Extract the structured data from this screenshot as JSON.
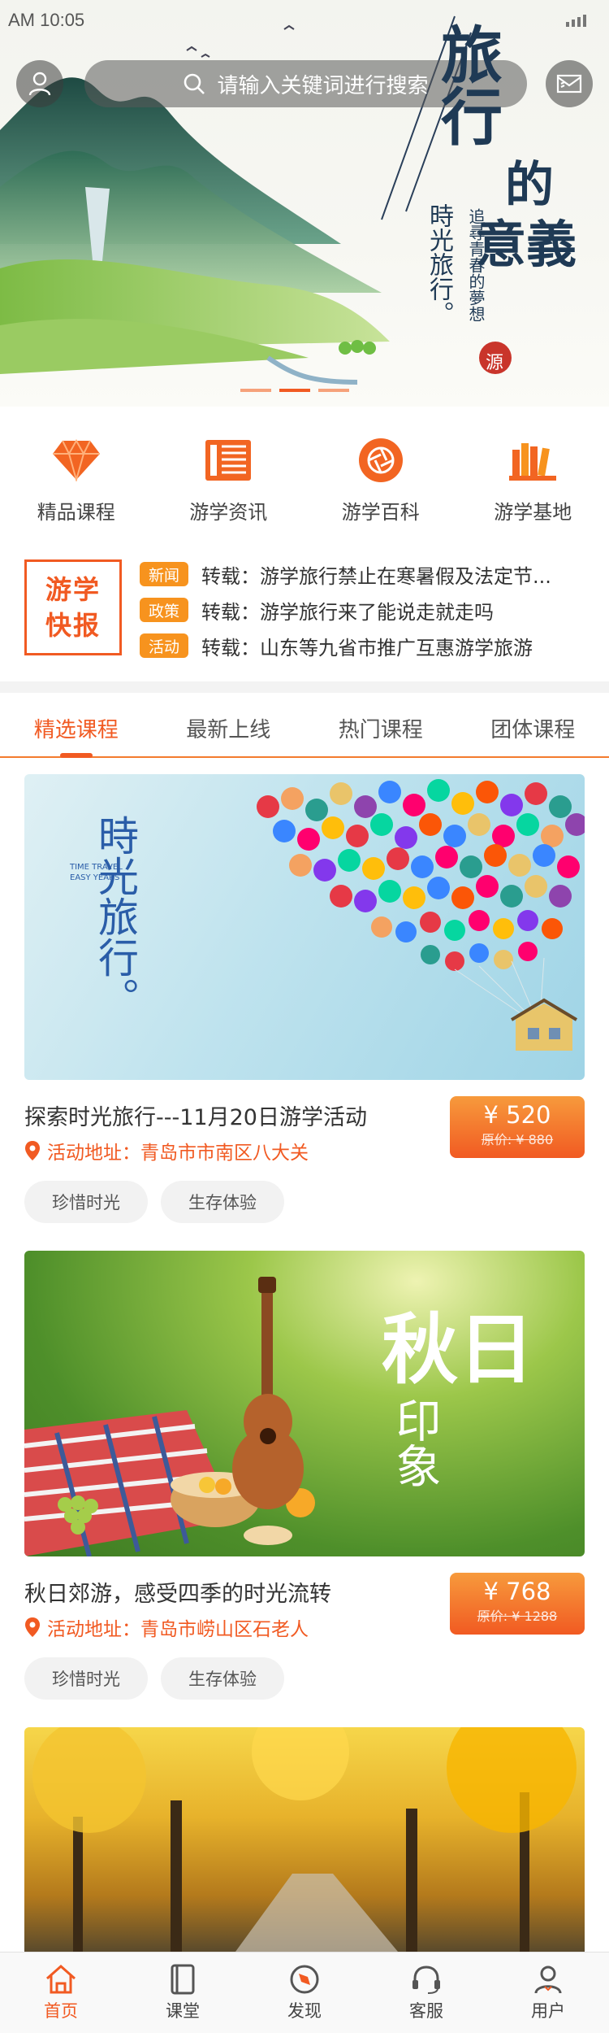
{
  "status_bar": {
    "time": "AM 10:05"
  },
  "search": {
    "placeholder": "请输入关键词进行搜索"
  },
  "hero": {
    "title_chars": [
      "旅",
      "行",
      "的",
      "意",
      "義"
    ],
    "subtitle_1": "時光旅行。",
    "subtitle_2": "追尋青春的夢想",
    "seal": "源",
    "slides_total": 3,
    "active_slide": 2
  },
  "quick_nav": [
    {
      "label": "精品课程",
      "icon": "diamond-icon"
    },
    {
      "label": "游学资讯",
      "icon": "newspaper-icon"
    },
    {
      "label": "游学百科",
      "icon": "aperture-icon"
    },
    {
      "label": "游学基地",
      "icon": "books-icon"
    }
  ],
  "news": {
    "badge_line1": "游学",
    "badge_line2": "快报",
    "items": [
      {
        "tag": "新闻",
        "text": "转载：游学旅行禁止在寒暑假及法定节..."
      },
      {
        "tag": "政策",
        "text": "转载：游学旅行来了能说走就走吗"
      },
      {
        "tag": "活动",
        "text": "转载：山东等九省市推广互惠游学旅游"
      }
    ]
  },
  "tabs": [
    {
      "label": "精选课程",
      "active": true
    },
    {
      "label": "最新上线",
      "active": false
    },
    {
      "label": "热门课程",
      "active": false
    },
    {
      "label": "团体课程",
      "active": false
    }
  ],
  "cards": [
    {
      "image_text": "時光旅行。",
      "image_small_text": "TIME TRAVEL EASY YEARS",
      "title": "探索时光旅行---11月20日游学活动",
      "address": "活动地址：青岛市市南区八大关",
      "price": "¥ 520",
      "old_price": "原价: ¥ 880",
      "chips": [
        "珍惜时光",
        "生存体验"
      ]
    },
    {
      "image_text_1": "秋日",
      "image_text_2": "印象",
      "title": "秋日郊游，感受四季的时光流转",
      "address": "活动地址：青岛市崂山区石老人",
      "price": "¥ 768",
      "old_price": "原价: ¥ 1288",
      "chips": [
        "珍惜时光",
        "生存体验"
      ]
    }
  ],
  "bottom_nav": [
    {
      "label": "首页",
      "icon": "home-icon",
      "active": true
    },
    {
      "label": "课堂",
      "icon": "book-icon",
      "active": false
    },
    {
      "label": "发现",
      "icon": "compass-icon",
      "active": false
    },
    {
      "label": "客服",
      "icon": "headset-icon",
      "active": false
    },
    {
      "label": "用户",
      "icon": "user-icon",
      "active": false
    }
  ],
  "colors": {
    "accent": "#f15a22",
    "accent_light": "#f7931e"
  }
}
